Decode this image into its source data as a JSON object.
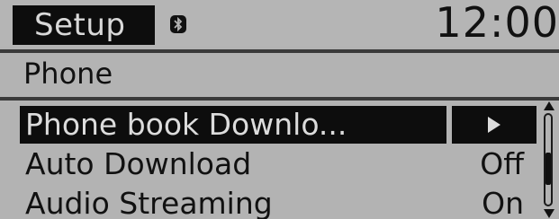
{
  "header": {
    "tab_label": "Setup",
    "bluetooth_icon": "bluetooth-icon",
    "clock": "12:00"
  },
  "section": {
    "title": "Phone"
  },
  "menu": {
    "items": [
      {
        "label": "Phone book Downlo...",
        "value": "",
        "icon": "play-arrow-icon",
        "selected": true
      },
      {
        "label": "Auto Download",
        "value": "Off",
        "selected": false
      },
      {
        "label": "Audio Streaming",
        "value": "On",
        "selected": false
      }
    ]
  },
  "colors": {
    "screen_bg": "#b3b3b3",
    "highlight_bg": "#0d0d0d",
    "text": "#111111",
    "highlight_text": "#dcdcdc"
  }
}
